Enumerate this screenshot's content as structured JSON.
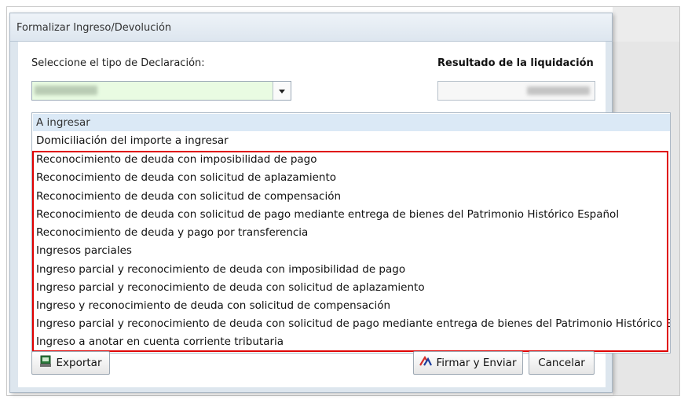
{
  "dialog": {
    "title": "Formalizar Ingreso/Devolución",
    "tipo_label": "Seleccione el tipo de Declaración:",
    "resultado_label": "Resultado de la liquidación"
  },
  "dropdown": {
    "options": [
      "A ingresar",
      "Domiciliación del importe a ingresar",
      "Reconocimiento de deuda con imposibilidad de pago",
      "Reconocimiento de deuda con solicitud de aplazamiento",
      "Reconocimiento de deuda con solicitud de compensación",
      "Reconocimiento de deuda con solicitud de pago mediante entrega de bienes del Patrimonio Histórico Español",
      "Reconocimiento de deuda y pago por transferencia",
      "Ingresos parciales",
      "Ingreso parcial y reconocimiento de deuda con imposibilidad de pago",
      "Ingreso parcial y reconocimiento de deuda con solicitud de aplazamiento",
      "Ingreso y reconocimiento de deuda con solicitud de compensación",
      "Ingreso parcial y reconocimiento de deuda con solicitud de pago mediante entrega de bienes del Patrimonio Histórico Españo",
      "Ingreso a anotar en cuenta corriente tributaria"
    ],
    "selected_index": 0
  },
  "buttons": {
    "export_label": "Exportar",
    "sign_label": "Firmar y Enviar",
    "cancel_label": "Cancelar"
  },
  "icons": {
    "export": "printer-icon",
    "sign": "signature-icon",
    "combo": "chevron-down-icon"
  },
  "colors": {
    "highlight_border": "#e00000",
    "selected_option": "#dbe9f6",
    "combo_bg": "#e9fbe2"
  }
}
